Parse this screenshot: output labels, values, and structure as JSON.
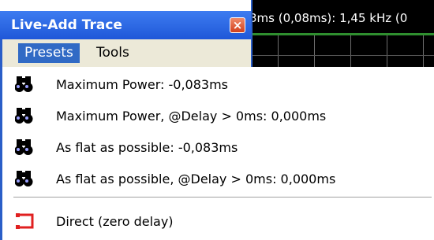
{
  "background": {
    "readout": "3ms (0,08ms): 1,45 kHz (0"
  },
  "window": {
    "title": "Live-Add Trace",
    "close_label": "×"
  },
  "menubar": {
    "presets_label": "Presets",
    "tools_label": "Tools"
  },
  "dropdown": {
    "items": [
      {
        "label": "Maximum Power: -0,083ms",
        "icon": "binoculars-icon"
      },
      {
        "label": "Maximum Power, @Delay > 0ms: 0,000ms",
        "icon": "binoculars-icon"
      },
      {
        "label": "As flat as possible: -0,083ms",
        "icon": "binoculars-icon"
      },
      {
        "label": "As flat as possible, @Delay > 0ms: 0,000ms",
        "icon": "binoculars-icon"
      },
      {
        "label": "Direct (zero delay)",
        "icon": "direct-connection-icon"
      }
    ]
  },
  "colors": {
    "title_bar": "#1f57d8",
    "menu_selected": "#316ac5",
    "graph_trace": "#2f8f2f",
    "direct_icon": "#e02020"
  }
}
